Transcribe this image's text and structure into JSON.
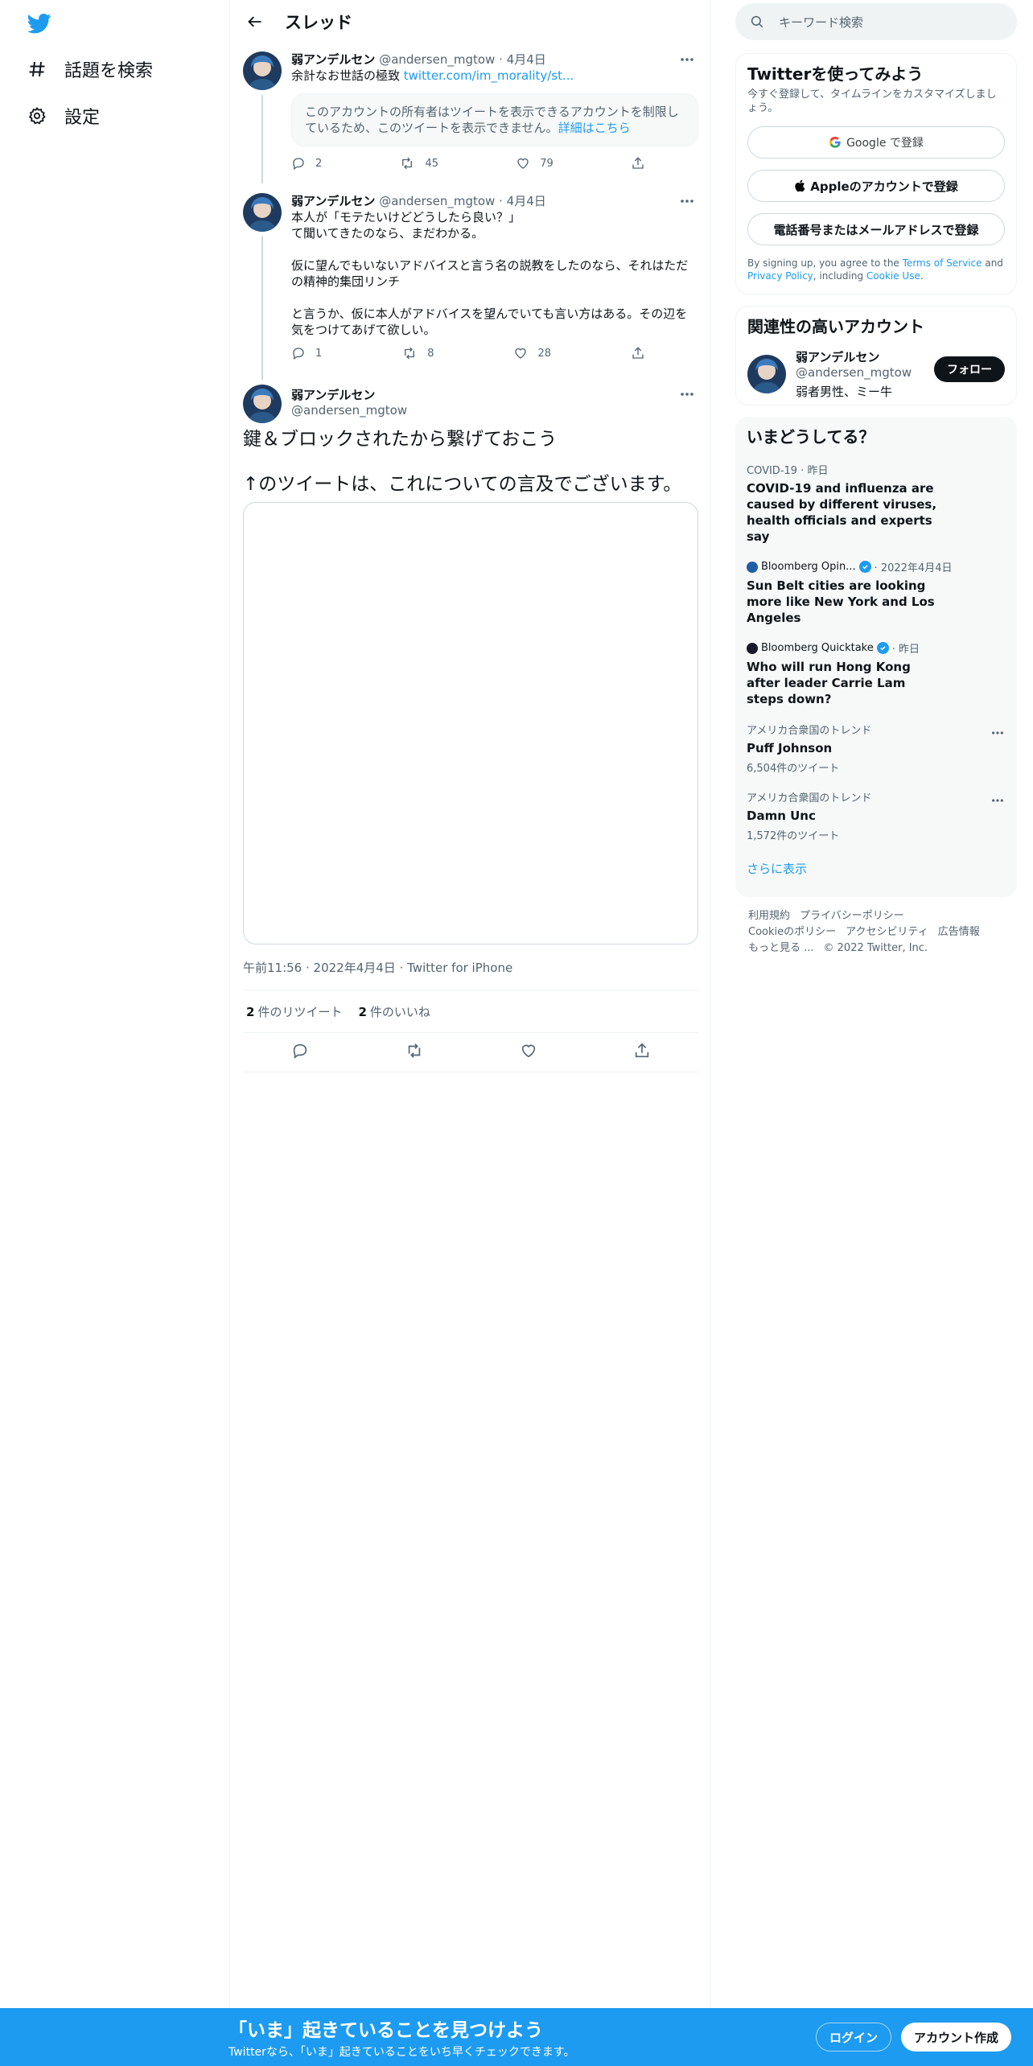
{
  "nav": {
    "logo": "twitter-bird-icon",
    "items": [
      {
        "label": "話題を検索",
        "icon": "hashtag-icon"
      },
      {
        "label": "設定",
        "icon": "gear-icon"
      }
    ]
  },
  "header": {
    "title": "スレッド"
  },
  "tweets": [
    {
      "name": "弱アンデルセン",
      "handle": "@andersen_mgtow",
      "date": "4月4日",
      "text": "余計なお世話の極致 ",
      "link": "twitter.com/im_morality/st...",
      "notice": "このアカウントの所有者はツイートを表示できるアカウントを制限しているため、このツイートを表示できません。",
      "notice_link": "詳細はこちら",
      "replies": "2",
      "retweets": "45",
      "likes": "79"
    },
    {
      "name": "弱アンデルセン",
      "handle": "@andersen_mgtow",
      "date": "4月4日",
      "text": "本人が「モテたいけどどうしたら良い？」\nて聞いてきたのなら、まだわかる。\n\n仮に望んでもいないアドバイスと言う名の説教をしたのなら、それはただの精神的集団リンチ\n\nと言うか、仮に本人がアドバイスを望んでいても言い方はある。その辺を気をつけてあげて欲しい。",
      "replies": "1",
      "retweets": "8",
      "likes": "28"
    }
  ],
  "main_tweet": {
    "name": "弱アンデルセン",
    "handle": "@andersen_mgtow",
    "text": "鍵＆ブロックされたから繋げておこう\n\n↑のツイートは、これについての言及でございます。",
    "time": "午前11:56",
    "date": "2022年4月4日",
    "source": "Twitter for iPhone",
    "retweets_num": "2",
    "retweets_label": "件のリツイート",
    "likes_num": "2",
    "likes_label": "件のいいね"
  },
  "search": {
    "placeholder": "キーワード検索"
  },
  "signup_panel": {
    "title": "Twitterを使ってみよう",
    "subtitle": "今すぐ登録して、タイムラインをカスタマイズしましょう。",
    "google": "Google で登録",
    "apple": "Appleのアカウントで登録",
    "phone": "電話番号またはメールアドレスで登録",
    "legal_prefix": "By signing up, you agree to the ",
    "tos": "Terms of Service",
    "legal_and": " and ",
    "privacy": "Privacy Policy",
    "legal_including": ", including ",
    "cookie": "Cookie Use",
    "legal_end": "."
  },
  "related": {
    "title": "関連性の高いアカウント",
    "name": "弱アンデルセン",
    "handle": "@andersen_mgtow",
    "bio": "弱者男性、ミー牛",
    "follow": "フォロー"
  },
  "trends": {
    "title": "いまどうしてる？",
    "items": [
      {
        "context": "COVID-19 · 昨日",
        "title": "COVID-19 and influenza are caused by different viruses, health officials and experts say"
      },
      {
        "source": "Bloomberg Opin...",
        "when": " · 2022年4月4日",
        "title": "Sun Belt cities are looking more like New York and Los Angeles"
      },
      {
        "source": "Bloomberg Quicktake",
        "when": " · 昨日",
        "title": "Who will run Hong Kong after leader Carrie Lam steps down?"
      },
      {
        "context": "アメリカ合衆国のトレンド",
        "title": "Puff Johnson",
        "count": "6,504件のツイート"
      },
      {
        "context": "アメリカ合衆国のトレンド",
        "title": "Damn Unc",
        "count": "1,572件のツイート"
      }
    ],
    "show_more": "さらに表示"
  },
  "footer": {
    "line1": [
      "利用規約",
      "プライバシーポリシー"
    ],
    "line2": [
      "Cookieのポリシー",
      "アクセシビリティ",
      "広告情報"
    ],
    "line3": [
      "もっと見る ...",
      "© 2022 Twitter, Inc."
    ]
  },
  "bottom_bar": {
    "title": "「いま」起きていることを見つけよう",
    "subtitle": "Twitterなら、「いま」起きていることをいち早くチェックできます。",
    "login": "ログイン",
    "signup": "アカウント作成"
  },
  "colors": {
    "accent": "#1d9bf0",
    "text": "#0f1419",
    "muted": "#536471"
  }
}
